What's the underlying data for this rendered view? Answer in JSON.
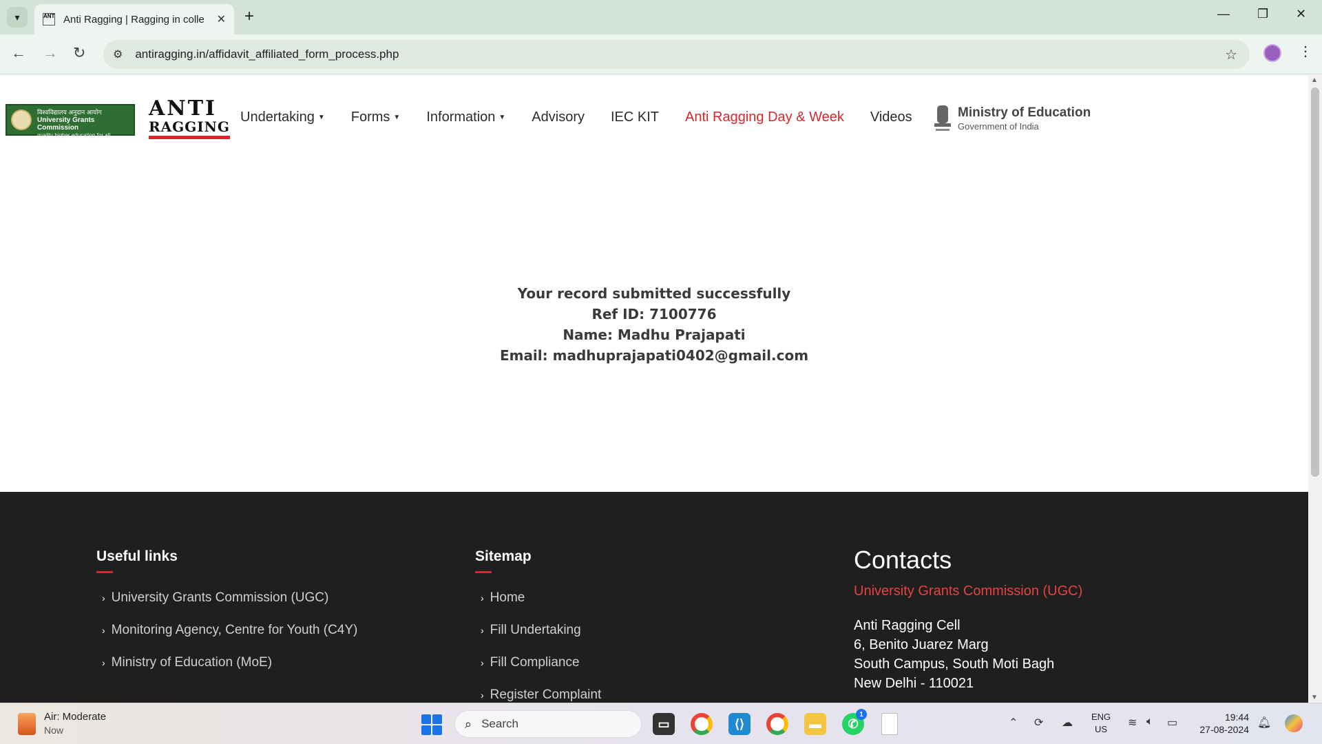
{
  "browser": {
    "tab_title": "Anti Ragging | Ragging in colle",
    "url": "antiragging.in/affidavit_affiliated_form_process.php",
    "favicon_text": "ANTI"
  },
  "header": {
    "ugc_logo_line1": "विश्वविद्यालय अनुदान आयोग",
    "ugc_logo_line2": "University Grants Commission",
    "ugc_logo_line3": "quality higher education for all",
    "anti_logo_line1": "ANTI",
    "anti_logo_line2": "RAGGING",
    "nav": [
      {
        "label": "Undertaking",
        "dropdown": true
      },
      {
        "label": "Forms",
        "dropdown": true
      },
      {
        "label": "Information",
        "dropdown": true
      },
      {
        "label": "Advisory",
        "dropdown": false
      },
      {
        "label": "IEC KIT",
        "dropdown": false
      },
      {
        "label": "Anti Ragging Day & Week",
        "dropdown": false,
        "active": true
      },
      {
        "label": "Videos",
        "dropdown": false
      }
    ],
    "moe_title": "Ministry of Education",
    "moe_subtitle": "Government of India"
  },
  "message": {
    "line1": "Your record submitted successfully",
    "line2": "Ref ID: 7100776",
    "line3": "Name: Madhu Prajapati",
    "line4": "Email: madhuprajapati0402@gmail.com"
  },
  "footer": {
    "useful_links_title": "Useful links",
    "useful_links": [
      "University Grants Commission (UGC)",
      "Monitoring Agency, Centre for Youth (C4Y)",
      "Ministry of Education (MoE)"
    ],
    "sitemap_title": "Sitemap",
    "sitemap": [
      "Home",
      "Fill Undertaking",
      "Fill Compliance",
      "Register Complaint"
    ],
    "contacts_title": "Contacts",
    "contacts_org": "University Grants Commission (UGC)",
    "contacts_address": [
      "Anti Ragging Cell",
      "6, Benito Juarez Marg",
      "South Campus, South Moti Bagh",
      "New Delhi - 110021"
    ]
  },
  "taskbar": {
    "weather_title": "Air: Moderate",
    "weather_sub": "Now",
    "search_placeholder": "Search",
    "whatsapp_badge": "1",
    "lang_line1": "ENG",
    "lang_line2": "US",
    "time": "19:44",
    "date": "27-08-2024"
  },
  "colors": {
    "accent_red": "#d9262c",
    "footer_bg": "#1f1f1f",
    "chrome_bg": "#d3e3d8"
  }
}
